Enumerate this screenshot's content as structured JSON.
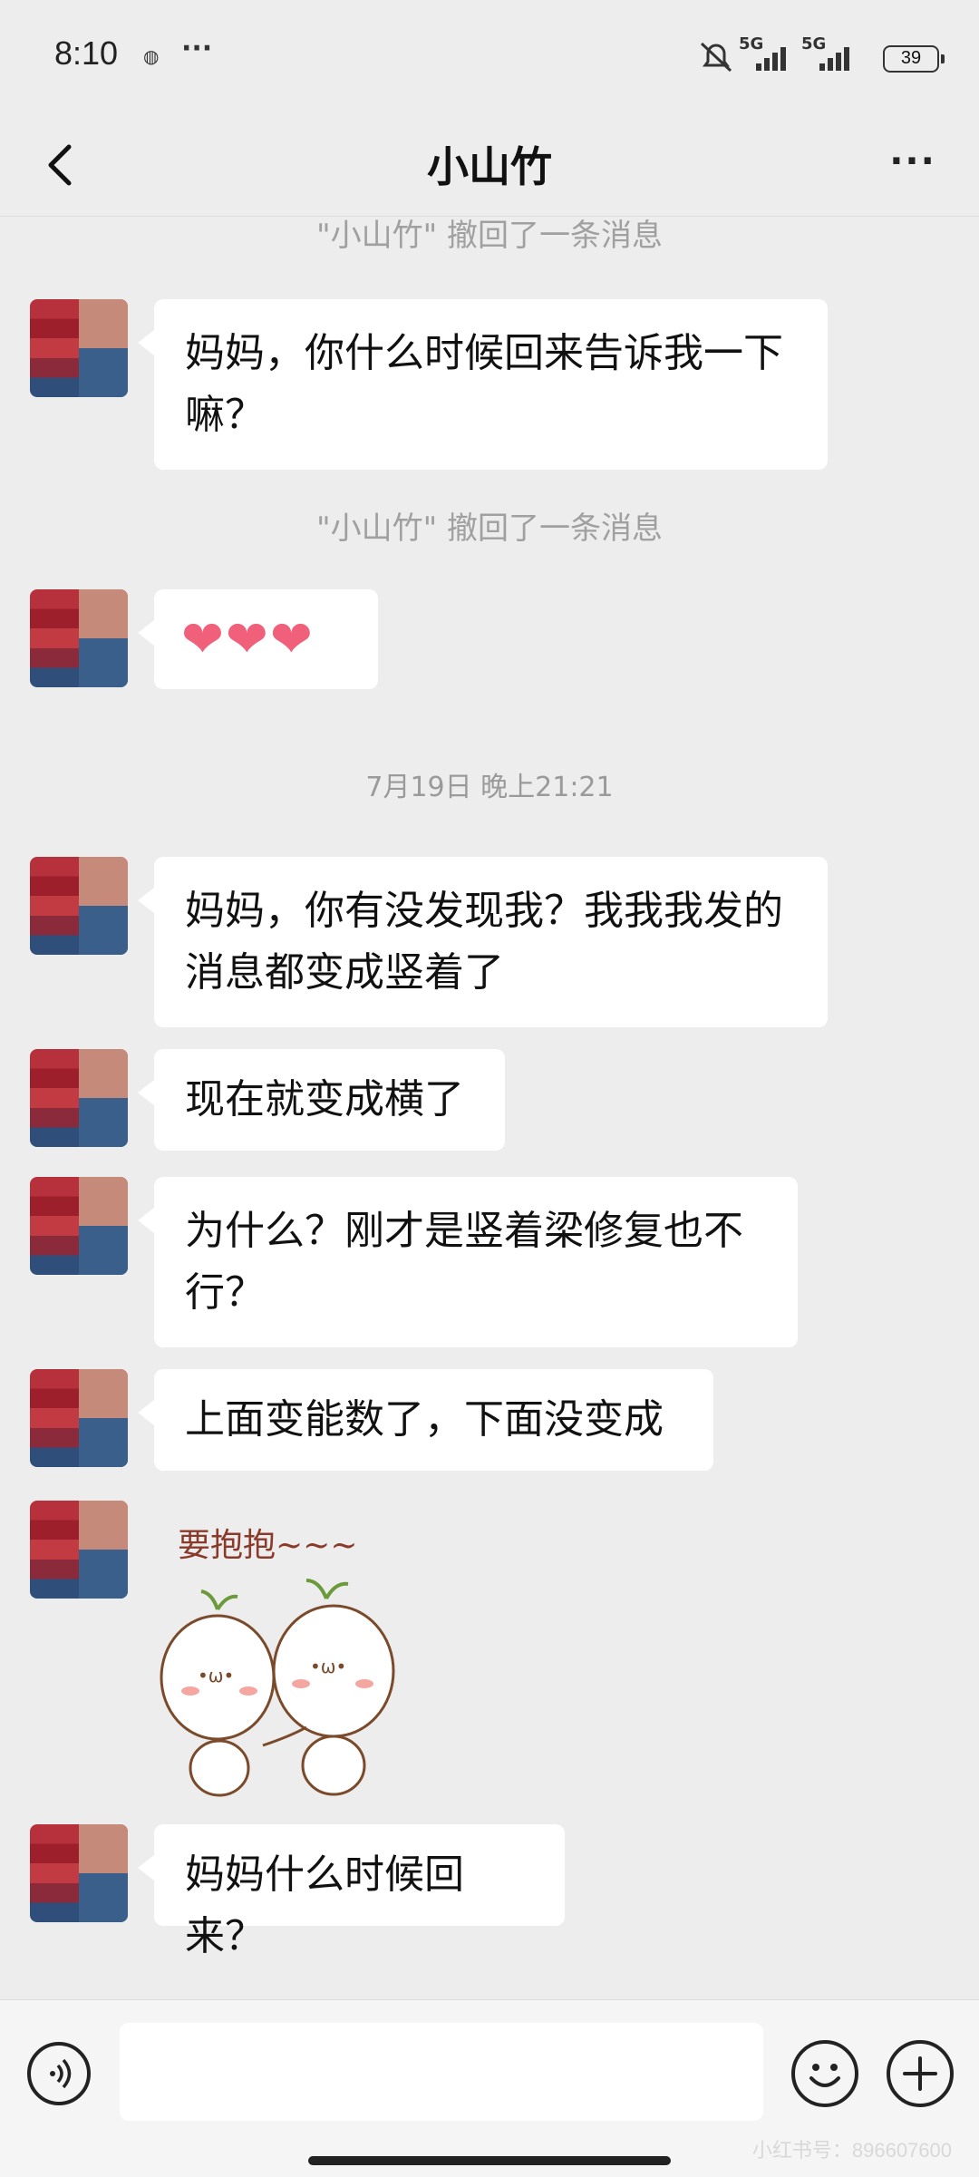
{
  "status_bar": {
    "time": "8:10",
    "network_1": "5G",
    "network_2": "5G",
    "battery": "39"
  },
  "header": {
    "title": "小山竹",
    "back_icon": "chevron-left-icon",
    "more_icon": "more-dots-icon"
  },
  "messages": {
    "recall_1": "\"小山竹\" 撤回了一条消息",
    "msg_1": "妈妈，你什么时候回来告诉我一下嘛？",
    "recall_2": "\"小山竹\" 撤回了一条消息",
    "msg_2": "❤❤❤",
    "timestamp": "7月19日 晚上21:21",
    "msg_3_line_1": "妈妈，你有没发现我？我我我发的",
    "msg_3_line_2": "消息都变成竖着了",
    "msg_4": "现在就变成横了",
    "msg_5_line_1": "为什么？刚才是竖着梁修复也不",
    "msg_5_line_2": "行？",
    "msg_6": "上面变能数了，下面没变成",
    "sticker_text": "要抱抱~~~",
    "msg_7": "妈妈什么时候回来？"
  },
  "bottom_bar": {
    "voice_icon": "voice-icon",
    "input_value": "",
    "emoji_icon": "emoji-icon",
    "plus_icon": "plus-icon",
    "watermark": "小红书号：896607600"
  },
  "colors": {
    "background": "#ededed",
    "bubble": "#ffffff",
    "system_text": "#a0a0a0",
    "heart": "#f0607a"
  }
}
